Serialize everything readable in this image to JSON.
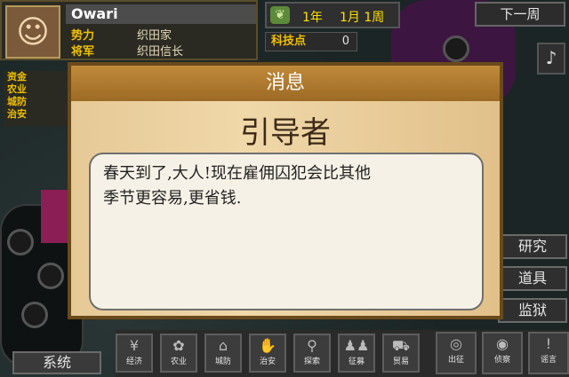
{
  "lord": {
    "name": "Owari",
    "rows": [
      {
        "label": "势力",
        "value": "织田家"
      },
      {
        "label": "将军",
        "value": "织田信长"
      }
    ],
    "side_stats": [
      "资金",
      "农业",
      "城防",
      "治安"
    ]
  },
  "date": {
    "year": "1年",
    "month": "1月",
    "week": "1周"
  },
  "next_week_label": "下一周",
  "tech": {
    "label": "科技点",
    "value": "0"
  },
  "right_buttons": [
    "研究",
    "道具",
    "监狱"
  ],
  "system_label": "系统",
  "toolbar": [
    {
      "label": "经济",
      "icon": "yen-icon"
    },
    {
      "label": "农业",
      "icon": "wheat-icon"
    },
    {
      "label": "城防",
      "icon": "castle-icon"
    },
    {
      "label": "治安",
      "icon": "hand-icon"
    },
    {
      "label": "探索",
      "icon": "search-icon"
    },
    {
      "label": "征募",
      "icon": "soldiers-icon"
    },
    {
      "label": "贸易",
      "icon": "cart-icon"
    },
    {
      "label": "出征",
      "icon": "target-icon"
    },
    {
      "label": "侦察",
      "icon": "eye-icon"
    },
    {
      "label": "谣言",
      "icon": "rumor-icon"
    }
  ],
  "dialog": {
    "title": "消息",
    "speaker": "引导者",
    "lines": [
      "春天到了,大人!现在雇佣囚犯会比其他",
      "季节更容易,更省钱."
    ]
  }
}
